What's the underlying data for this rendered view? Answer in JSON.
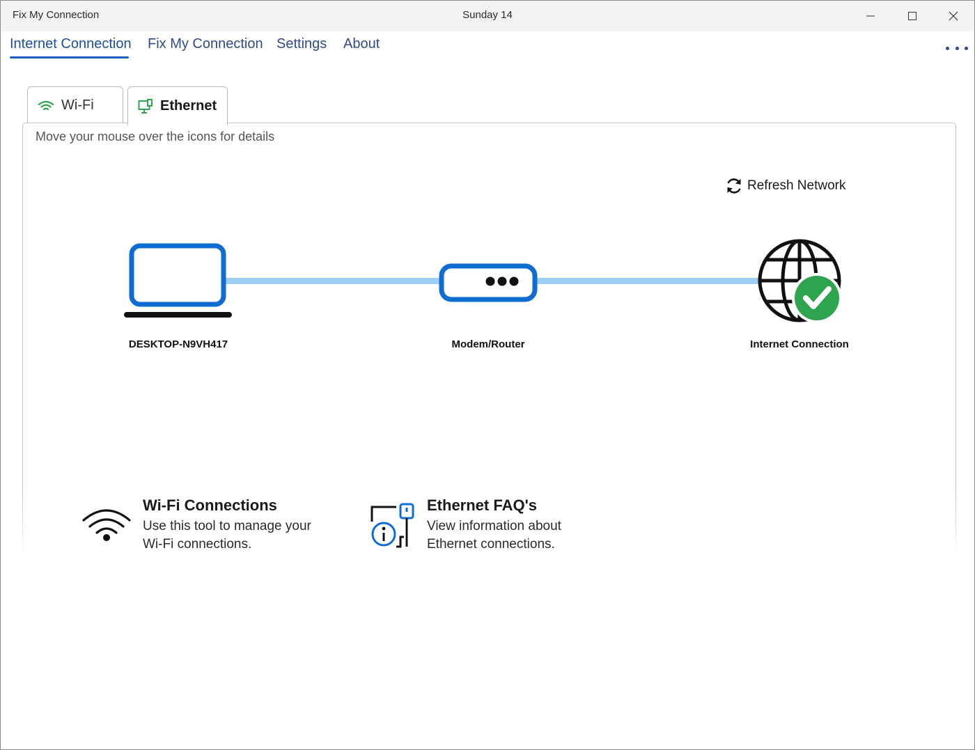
{
  "window": {
    "app_title": "Fix My Connection",
    "center_title": "Sunday 14"
  },
  "nav": {
    "items": [
      {
        "label": "Internet Connection",
        "active": true
      },
      {
        "label": "Fix My Connection",
        "active": false
      },
      {
        "label": "Settings",
        "active": false
      },
      {
        "label": "About",
        "active": false
      }
    ],
    "more_icon": "more-horizontal-icon"
  },
  "tabs": [
    {
      "label": "Wi-Fi",
      "icon": "wifi-icon",
      "selected": false
    },
    {
      "label": "Ethernet",
      "icon": "ethernet-icon",
      "selected": true
    }
  ],
  "panel": {
    "hint": "Move your mouse over the icons for details",
    "refresh_label": "Refresh Network",
    "refresh_icon": "refresh-icon"
  },
  "network": {
    "nodes": [
      {
        "label": "DESKTOP-N9VH417",
        "icon": "laptop-icon"
      },
      {
        "label": "Modem/Router",
        "icon": "router-icon"
      },
      {
        "label": "Internet Connection",
        "icon": "globe-check-icon",
        "status": "connected"
      }
    ]
  },
  "tools": [
    {
      "title": "Wi-Fi Connections",
      "desc": "Use this tool to manage your Wi-Fi connections.",
      "icon": "wifi-icon"
    },
    {
      "title": "Ethernet FAQ's",
      "desc": "View information about Ethernet connections.",
      "icon": "ethernet-info-icon"
    }
  ],
  "colors": {
    "accent_blue": "#0f6cd0",
    "link_line": "#9fd0f3",
    "success_green": "#2ea44f",
    "nav_text": "#2f4a8a"
  }
}
